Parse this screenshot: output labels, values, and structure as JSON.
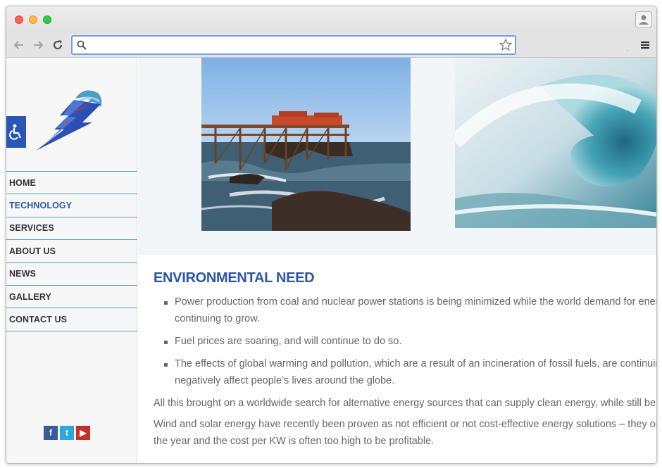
{
  "browser": {
    "address_value": "",
    "address_placeholder": ""
  },
  "sidebar": {
    "nav": [
      {
        "label": "HOME",
        "active": false
      },
      {
        "label": "TECHNOLOGY",
        "active": true
      },
      {
        "label": "SERVICES",
        "active": false
      },
      {
        "label": "ABOUT US",
        "active": false
      },
      {
        "label": "NEWS",
        "active": false
      },
      {
        "label": "GALLERY",
        "active": false
      },
      {
        "label": "CONTACT US",
        "active": false
      }
    ],
    "social": {
      "facebook_glyph": "f",
      "twitter_glyph": "t",
      "youtube_glyph": "▶"
    }
  },
  "main": {
    "section_title": "ENVIRONMENTAL NEED",
    "bullets": [
      "Power production from coal and nuclear power stations is being minimized while the world demand for energy\ncontinuing to grow.",
      "Fuel prices are soaring, and will continue to do so.",
      "The effects of global warming and pollution, which are a result of an incineration of fossil fuels, are continuing t\nnegatively affect people’s lives around the globe."
    ],
    "paragraphs": [
      "All this brought on a worldwide search for alternative energy sources that can supply clean energy, while still being c",
      "Wind and solar energy have recently been proven as not efficient or not cost-effective energy solutions – they operat\nthe year and the cost per KW is often too high to be profitable."
    ]
  },
  "colors": {
    "accent_blue": "#2b56a8",
    "nav_divider": "#4ea3b5",
    "hero_band": "#f2f6f8"
  },
  "icons": [
    "back-arrow-icon",
    "forward-arrow-icon",
    "reload-icon",
    "search-icon",
    "star-icon",
    "menu-icon",
    "profile-icon",
    "accessibility-icon",
    "lightning-wave-logo",
    "facebook-icon",
    "twitter-icon",
    "youtube-icon"
  ]
}
